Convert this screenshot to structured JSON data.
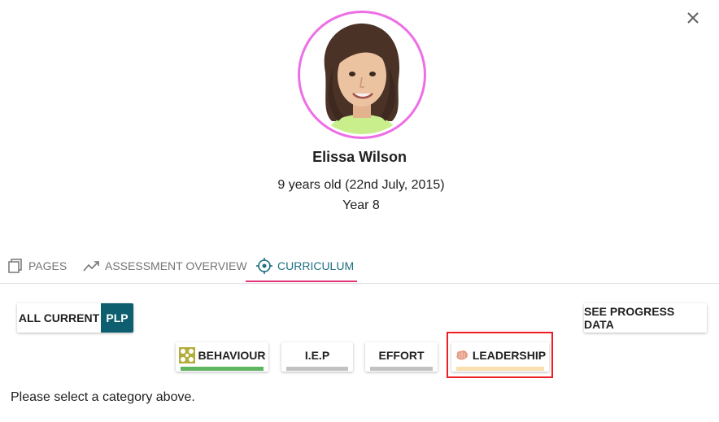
{
  "header": {
    "close_icon": "close-icon"
  },
  "student": {
    "name": "Elissa Wilson",
    "age_line": "9 years old (22nd July, 2015)",
    "year_line": "Year 8",
    "avatar_ring_color": "#ee6ee6"
  },
  "tabs": [
    {
      "label": "PAGES",
      "icon": "pages-icon",
      "active": false
    },
    {
      "label": "ASSESSMENT OVERVIEW",
      "icon": "trending-up-icon",
      "active": false
    },
    {
      "label": "CURRICULUM",
      "icon": "target-icon",
      "active": true
    }
  ],
  "toggle": {
    "all_current_label": "ALL CURRENT",
    "plp_label": "PLP",
    "selected": "PLP"
  },
  "progress_button": {
    "label": "SEE PROGRESS DATA"
  },
  "categories": [
    {
      "label": "BEHAVIOUR",
      "icon": "behaviour-icon",
      "bar_color": "#5fb55f"
    },
    {
      "label": "I.E.P",
      "icon": "",
      "bar_color": "#c2c2c2"
    },
    {
      "label": "EFFORT",
      "icon": "",
      "bar_color": "#c2c2c2"
    },
    {
      "label": "LEADERSHIP",
      "icon": "brain-icon",
      "bar_color": "#fae0b0",
      "highlighted": true
    }
  ],
  "colors": {
    "accent": "#1f6f83",
    "tab_indicator": "#e3327a",
    "plp_bg": "#0d5e6e",
    "highlight": "#ee1c24"
  },
  "prompt": "Please select a category above."
}
